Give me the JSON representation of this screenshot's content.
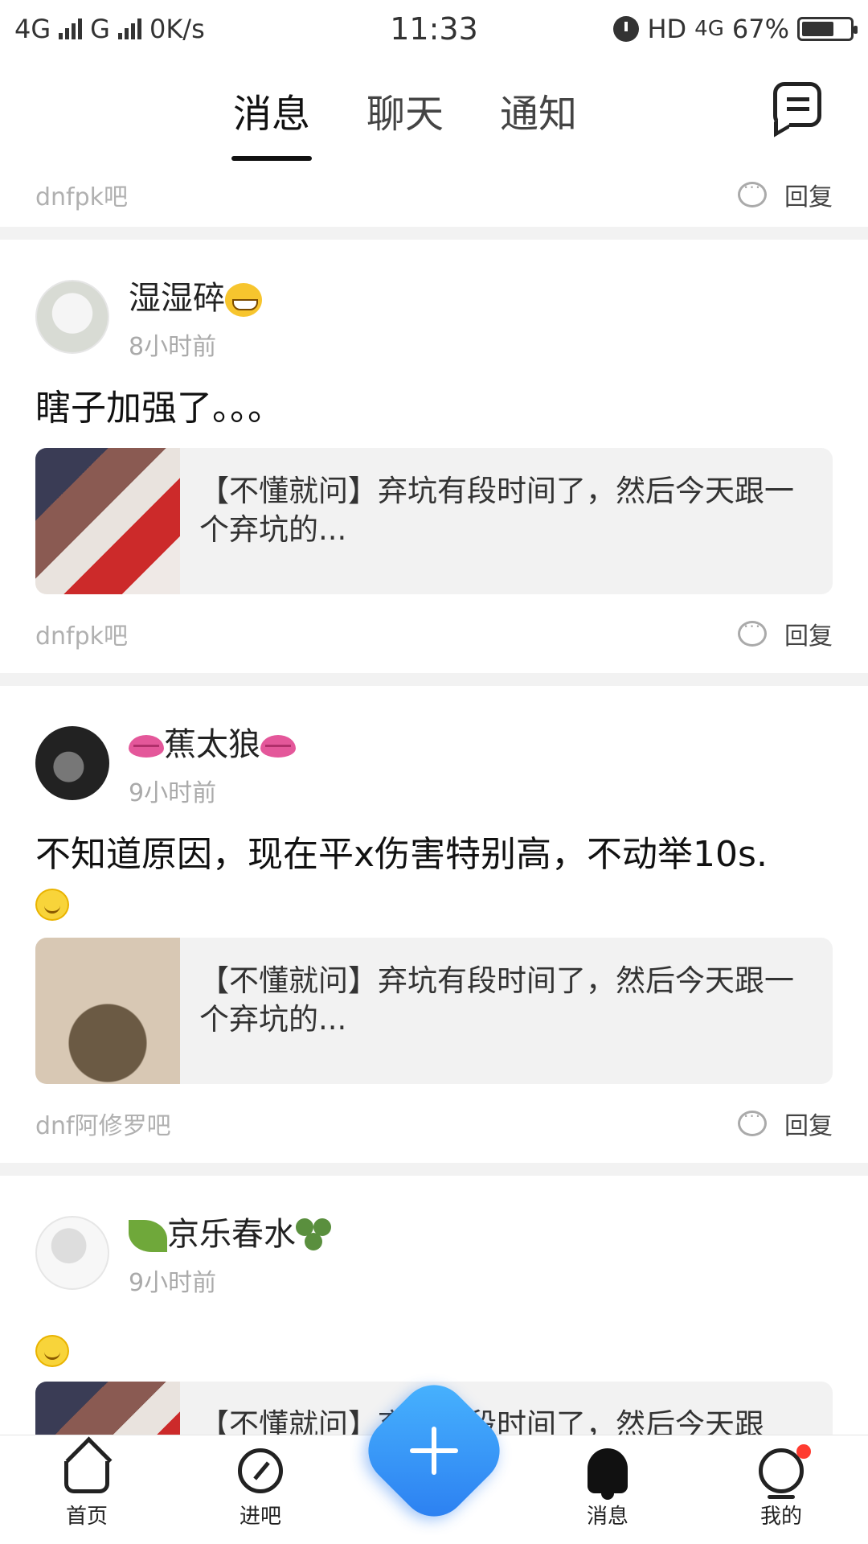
{
  "status_bar": {
    "network_1": "4G",
    "network_2": "G",
    "speed": "0K/s",
    "time": "11:33",
    "hd": "HD",
    "network_3": "4G",
    "battery_text": "67%",
    "battery_level": 0.67
  },
  "top_tabs": [
    {
      "label": "消息",
      "active": true
    },
    {
      "label": "聊天",
      "active": false
    },
    {
      "label": "通知",
      "active": false
    }
  ],
  "partial_top": {
    "forum": "dnfpk吧",
    "reply": "回复"
  },
  "posts": [
    {
      "username": "湿湿碎",
      "time": "8小时前",
      "content": "瞎子加强了。。。",
      "quote": "【不懂就问】弃坑有段时间了，然后今天跟一个弃坑的...",
      "forum": "dnfpk吧",
      "reply": "回复"
    },
    {
      "username": "蕉太狼",
      "time": "9小时前",
      "content": "不知道原因，现在平x伤害特别高，不动举10s.",
      "quote": "【不懂就问】弃坑有段时间了，然后今天跟一个弃坑的...",
      "forum": "dnf阿修罗吧",
      "reply": "回复"
    },
    {
      "username": "京乐春水",
      "time": "9小时前",
      "content": "",
      "quote": "【不懂就问】弃坑有段时间了，然后今天跟"
    }
  ],
  "bottom_nav": [
    {
      "label": "首页",
      "icon": "home-icon"
    },
    {
      "label": "进吧",
      "icon": "compass-icon"
    },
    {
      "label": "消息",
      "icon": "bell-icon"
    },
    {
      "label": "我的",
      "icon": "profile-icon"
    }
  ],
  "colors": {
    "accent": "#2a7cf0",
    "badge": "#ff3b30",
    "muted_text": "#aaaaaa"
  }
}
